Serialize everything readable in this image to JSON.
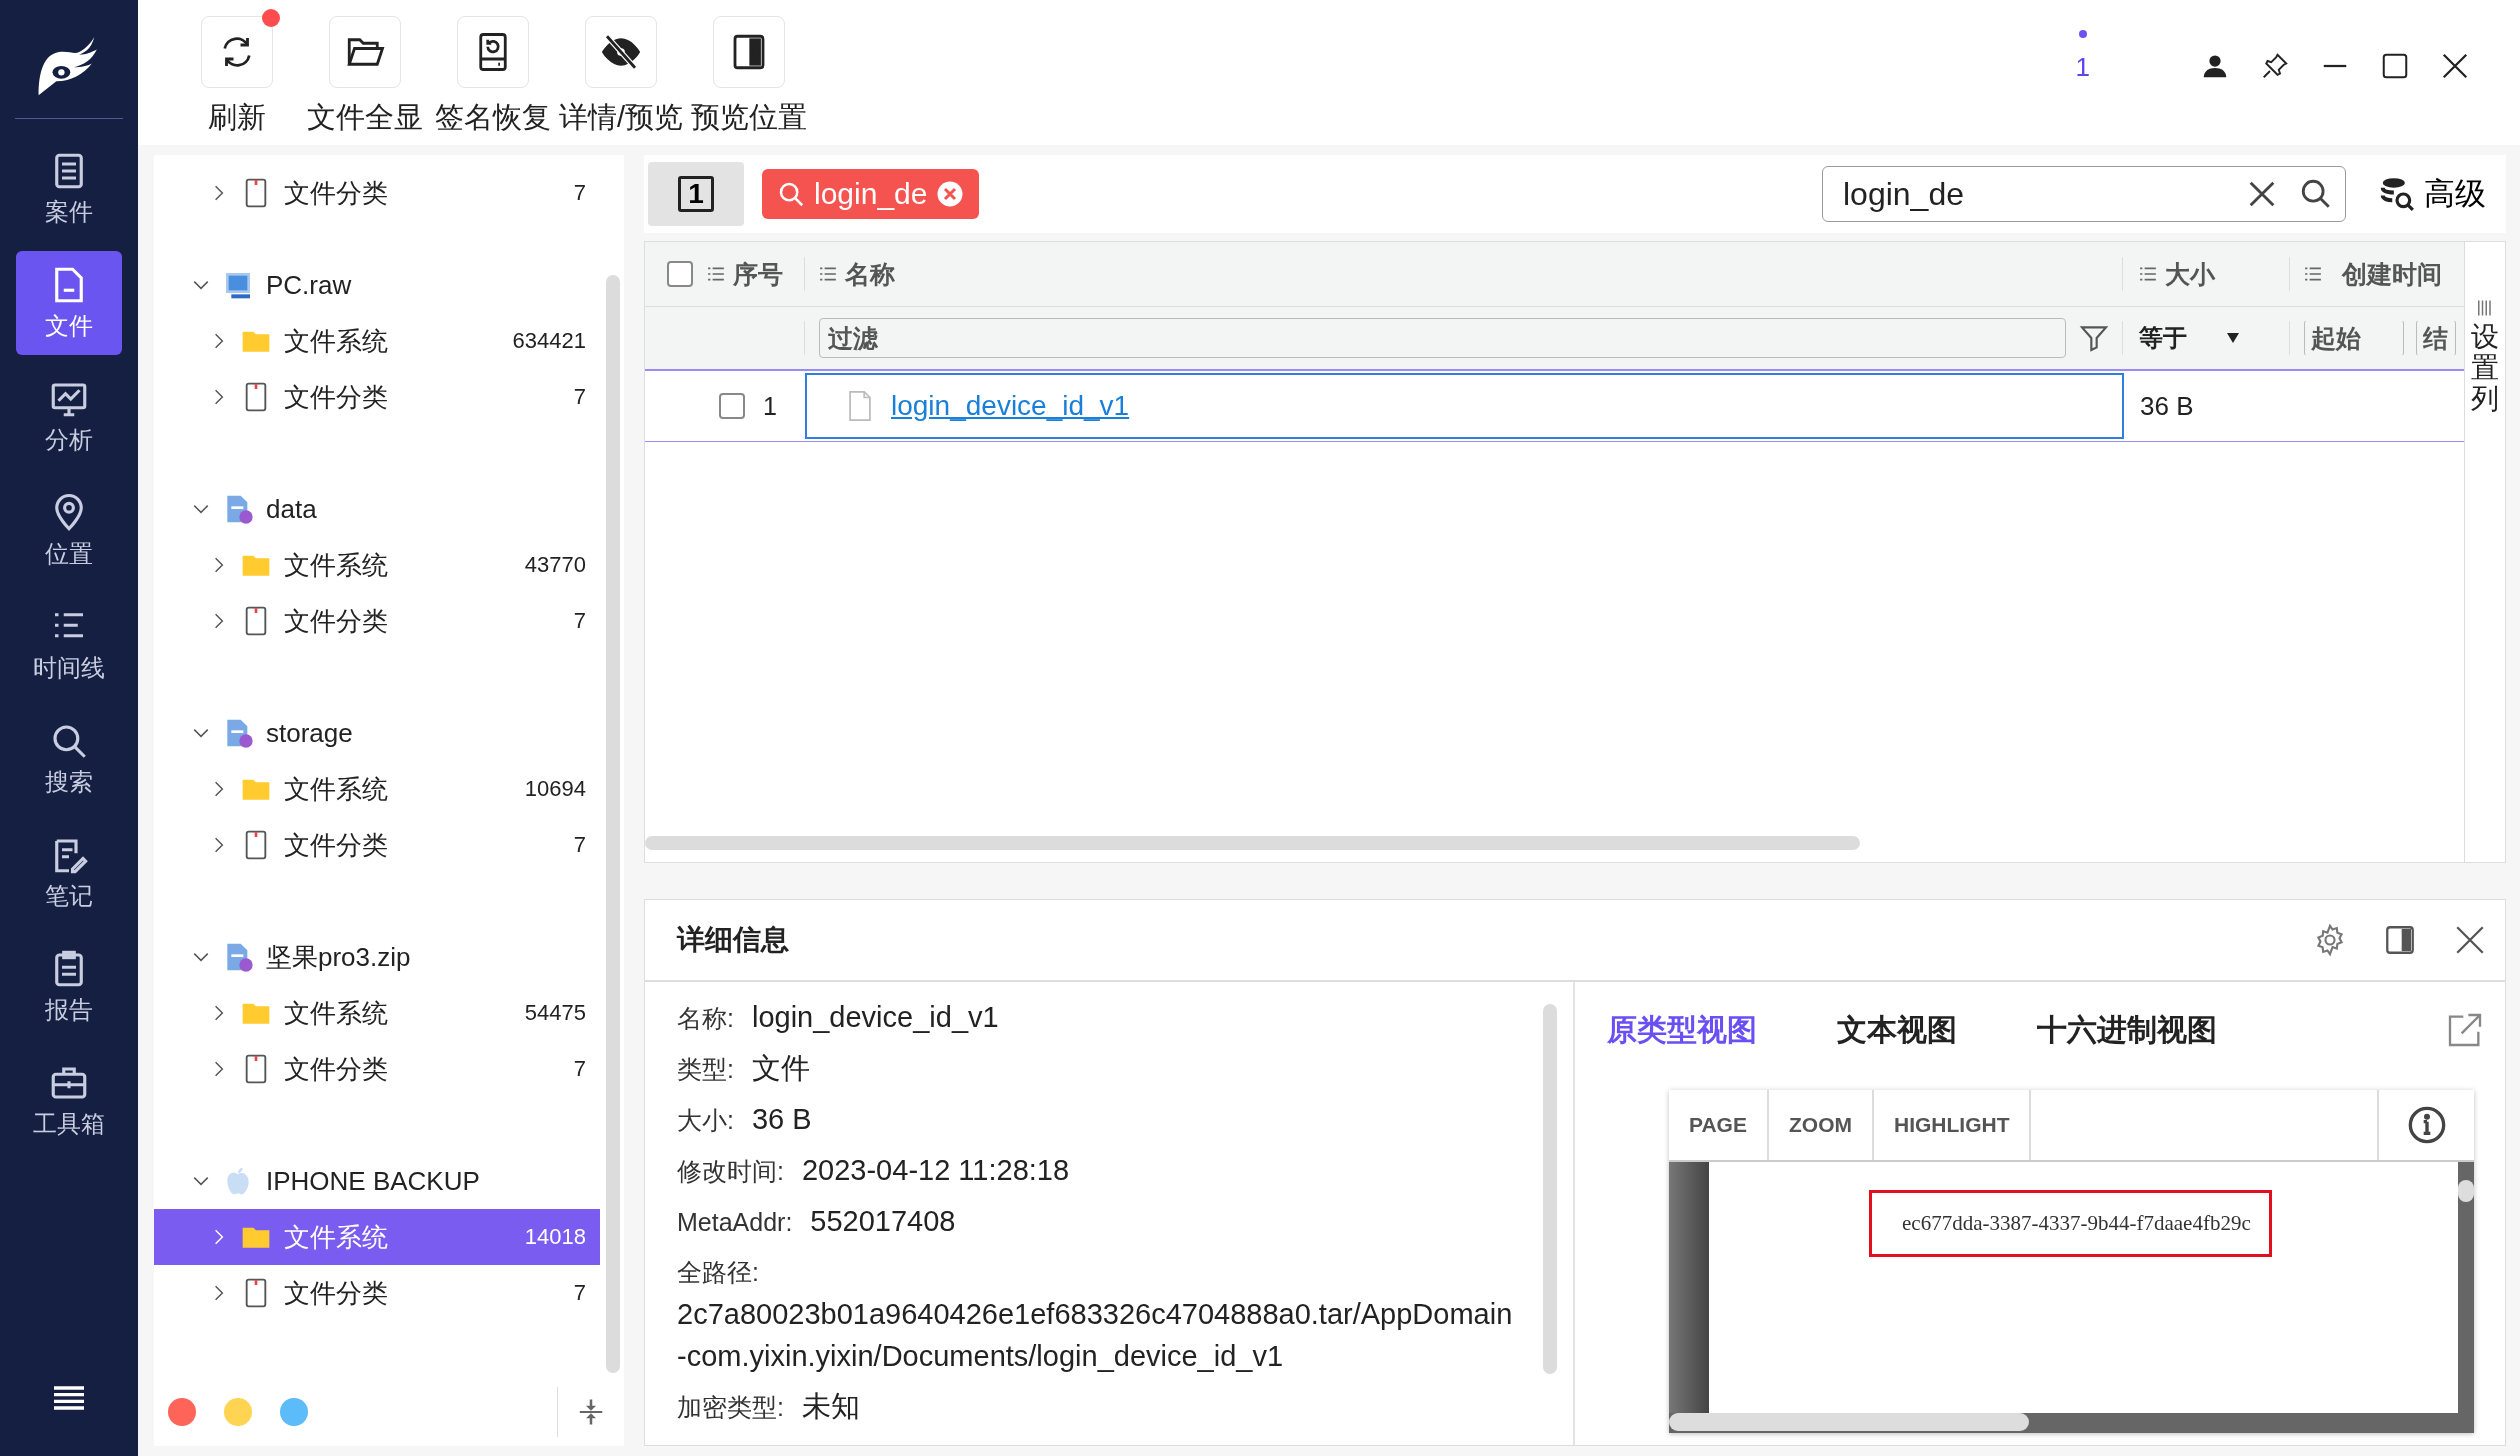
{
  "nav": [
    {
      "label": "案件",
      "selected": false
    },
    {
      "label": "文件",
      "selected": true
    },
    {
      "label": "分析",
      "selected": false
    },
    {
      "label": "位置",
      "selected": false
    },
    {
      "label": "时间线",
      "selected": false
    },
    {
      "label": "搜索",
      "selected": false
    },
    {
      "label": "笔记",
      "selected": false
    },
    {
      "label": "报告",
      "selected": false
    },
    {
      "label": "工具箱",
      "selected": false
    }
  ],
  "toolbar": [
    {
      "label": "刷新",
      "notification": true
    },
    {
      "label": "文件全显",
      "notification": false
    },
    {
      "label": "签名恢复",
      "notification": false
    },
    {
      "label": "详情/预览",
      "notification": false
    },
    {
      "label": "预览位置",
      "notification": false
    }
  ],
  "window_controls": {
    "counter": "1"
  },
  "tree": [
    {
      "label": "文件分类",
      "kind": "category",
      "count": "7",
      "selected": false,
      "expanded": false
    },
    {
      "label": "PC.raw",
      "kind": "disk",
      "expanded": true,
      "children": [
        {
          "label": "文件系统",
          "kind": "filesystem",
          "count": "634421",
          "selected": false,
          "expanded": false
        },
        {
          "label": "文件分类",
          "kind": "category",
          "count": "7",
          "selected": false,
          "expanded": false
        }
      ]
    },
    {
      "label": "data",
      "kind": "image",
      "expanded": true,
      "children": [
        {
          "label": "文件系统",
          "kind": "filesystem",
          "count": "43770",
          "selected": false,
          "expanded": false
        },
        {
          "label": "文件分类",
          "kind": "category",
          "count": "7",
          "selected": false,
          "expanded": false
        }
      ]
    },
    {
      "label": "storage",
      "kind": "image",
      "expanded": true,
      "children": [
        {
          "label": "文件系统",
          "kind": "filesystem",
          "count": "10694",
          "selected": false,
          "expanded": false
        },
        {
          "label": "文件分类",
          "kind": "category",
          "count": "7",
          "selected": false,
          "expanded": false
        }
      ]
    },
    {
      "label": "坚果pro3.zip",
      "kind": "image",
      "expanded": true,
      "children": [
        {
          "label": "文件系统",
          "kind": "filesystem",
          "count": "54475",
          "selected": false,
          "expanded": false
        },
        {
          "label": "文件分类",
          "kind": "category",
          "count": "7",
          "selected": false,
          "expanded": false
        }
      ]
    },
    {
      "label": "IPHONE BACKUP",
      "kind": "apple",
      "expanded": true,
      "children": [
        {
          "label": "文件系统",
          "kind": "filesystem",
          "count": "14018",
          "selected": true,
          "expanded": false
        },
        {
          "label": "文件分类",
          "kind": "category",
          "count": "7",
          "selected": false,
          "expanded": false
        }
      ]
    }
  ],
  "color_dots": [
    {
      "color": "#ff6459"
    },
    {
      "color": "#ffd452"
    },
    {
      "color": "#5bbcf9"
    }
  ],
  "search": {
    "page_button": "1",
    "tag": "login_de",
    "value": "login_de",
    "advanced_button": "高级"
  },
  "table": {
    "select_all_checked": false,
    "columns": [
      "序号",
      "名称",
      "大小",
      "创建时间"
    ],
    "filter": {
      "placeholder": "过滤",
      "operator": "等于",
      "start_placeholder": "起始",
      "end_placeholder": "结"
    },
    "column_settings": "设置列",
    "rows": [
      {
        "index": "1",
        "name": "login_device_id_v1",
        "size": "36 B",
        "checked": false,
        "selected": true
      }
    ]
  },
  "details": {
    "title": "详细信息",
    "fields": [
      {
        "label": "名称:",
        "value": "login_device_id_v1"
      },
      {
        "label": "类型:",
        "value": "文件"
      },
      {
        "label": "大小:",
        "value": "36 B"
      },
      {
        "label": "修改时间:",
        "value": "2023-04-12 11:28:18"
      },
      {
        "label": "MetaAddr:",
        "value": "552017408"
      },
      {
        "label": "全路径:",
        "value": "2c7a80023b01a9640426e1ef683326c4704888a0.tar/AppDomain-com.yixin.yixin/Documents/login_device_id_v1",
        "kind": "block"
      },
      {
        "label": "加密类型:",
        "value": "未知"
      }
    ],
    "tabs": [
      {
        "label": "原类型视图",
        "selected": true
      },
      {
        "label": "文本视图",
        "selected": false
      },
      {
        "label": "十六进制视图",
        "selected": false
      }
    ],
    "preview_tools": [
      "PAGE",
      "ZOOM",
      "HIGHLIGHT"
    ],
    "preview_text": "ec677dda-3387-4337-9b44-f7daae4fb29c"
  }
}
